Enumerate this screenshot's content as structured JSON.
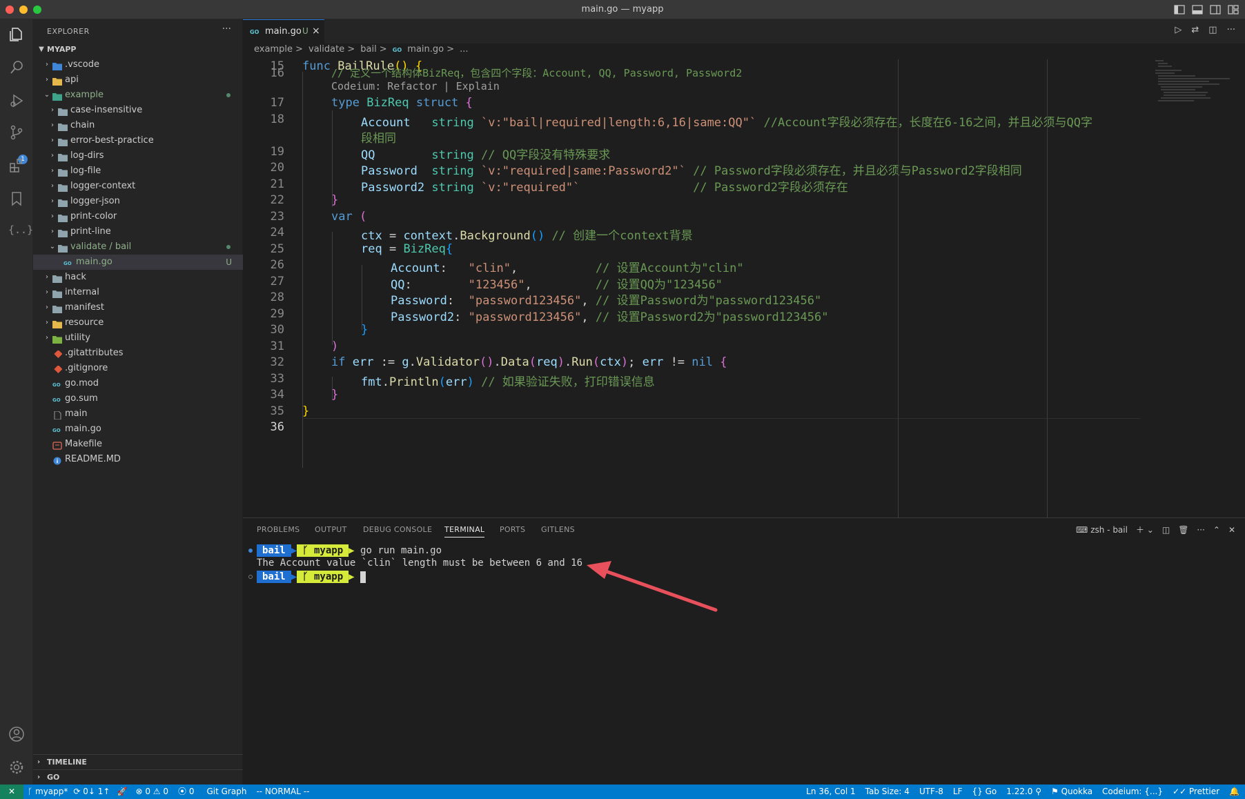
{
  "window": {
    "title": "main.go — myapp"
  },
  "explorer": {
    "header": "EXPLORER",
    "more": "···",
    "root": "MYAPP",
    "items": [
      {
        "label": ".vscode",
        "indent": 0,
        "type": "folder",
        "expanded": false
      },
      {
        "label": "api",
        "indent": 0,
        "type": "folder",
        "expanded": false
      },
      {
        "label": "example",
        "indent": 0,
        "type": "folder",
        "expanded": true,
        "status": "dot"
      },
      {
        "label": "case-insensitive",
        "indent": 1,
        "type": "folder",
        "expanded": false
      },
      {
        "label": "chain",
        "indent": 1,
        "type": "folder",
        "expanded": false
      },
      {
        "label": "error-best-practice",
        "indent": 1,
        "type": "folder",
        "expanded": false
      },
      {
        "label": "log-dirs",
        "indent": 1,
        "type": "folder",
        "expanded": false
      },
      {
        "label": "log-file",
        "indent": 1,
        "type": "folder",
        "expanded": false
      },
      {
        "label": "logger-context",
        "indent": 1,
        "type": "folder",
        "expanded": false
      },
      {
        "label": "logger-json",
        "indent": 1,
        "type": "folder",
        "expanded": false
      },
      {
        "label": "print-color",
        "indent": 1,
        "type": "folder",
        "expanded": false
      },
      {
        "label": "print-line",
        "indent": 1,
        "type": "folder",
        "expanded": false
      },
      {
        "label": "validate / bail",
        "indent": 1,
        "type": "folder",
        "expanded": true,
        "status": "dot"
      },
      {
        "label": "main.go",
        "indent": 2,
        "type": "go",
        "selected": true,
        "status": "U"
      },
      {
        "label": "hack",
        "indent": 0,
        "type": "folder",
        "expanded": false
      },
      {
        "label": "internal",
        "indent": 0,
        "type": "folder",
        "expanded": false
      },
      {
        "label": "manifest",
        "indent": 0,
        "type": "folder",
        "expanded": false
      },
      {
        "label": "resource",
        "indent": 0,
        "type": "folder",
        "expanded": false
      },
      {
        "label": "utility",
        "indent": 0,
        "type": "folder",
        "expanded": false
      },
      {
        "label": ".gitattributes",
        "indent": 0,
        "type": "git"
      },
      {
        "label": ".gitignore",
        "indent": 0,
        "type": "git"
      },
      {
        "label": "go.mod",
        "indent": 0,
        "type": "go"
      },
      {
        "label": "go.sum",
        "indent": 0,
        "type": "go"
      },
      {
        "label": "main",
        "indent": 0,
        "type": "file"
      },
      {
        "label": "main.go",
        "indent": 0,
        "type": "go"
      },
      {
        "label": "Makefile",
        "indent": 0,
        "type": "make"
      },
      {
        "label": "README.MD",
        "indent": 0,
        "type": "info"
      }
    ],
    "sections": [
      "TIMELINE",
      "GO"
    ]
  },
  "activity": {
    "scm_badge": "1"
  },
  "tab": {
    "icon": "GO",
    "name": "main.go",
    "status": "U",
    "close": "×"
  },
  "breadcrumb": [
    "example",
    ">",
    "validate",
    ">",
    "bail",
    ">",
    "GO",
    "main.go",
    ">",
    "..."
  ],
  "code": {
    "lens": "Codeium: Refactor | Explain",
    "comment16": "// 定义一个结构体BizReq，包含四个字段：Account, QQ, Password, Password2",
    "account_tag": "`v:\"bail|required|length:6,16|same:QQ\"`",
    "account_comment": "//Account字段必须存在，长度在6-16之间，并且必须与QQ字",
    "account_comment2": "段相同",
    "qq_comment": "// QQ字段没有特殊要求",
    "pwd_tag": "`v:\"required|same:Password2\"`",
    "pwd_comment": "// Password字段必须存在，并且必须与Password2字段相同",
    "pwd2_tag": "`v:\"required\"`",
    "pwd2_comment": "// Password2字段必须存在",
    "ctx_comment": "// 创建一个context背景",
    "acc_val": "\"clin\"",
    "acc_cm": "// 设置Account为\"clin\"",
    "qq_val": "\"123456\"",
    "qq_cm": "// 设置QQ为\"123456\"",
    "pw_val": "\"password123456\"",
    "pw_cm": "// 设置Password为\"password123456\"",
    "pw2_cm": "// 设置Password2为\"password123456\"",
    "err_comment": "// 如果验证失败，打印错误信息"
  },
  "panel": {
    "tabs": [
      "PROBLEMS",
      "OUTPUT",
      "DEBUG CONSOLE",
      "TERMINAL",
      "PORTS",
      "GITLENS"
    ],
    "active_tab": "TERMINAL",
    "shell": "zsh - bail",
    "prompt_dir": "bail",
    "prompt_repo": "myapp",
    "command": "go run main.go",
    "output": "The Account value `clin` length must be between 6 and 16"
  },
  "status": {
    "branch": "myapp*",
    "sync": "0↓ 1↑",
    "problems": "0",
    "warnings": "0",
    "ports": "0",
    "git_graph": "Git Graph",
    "mode": "-- NORMAL --",
    "position": "Ln 36, Col 1",
    "tab_size": "Tab Size: 4",
    "encoding": "UTF-8",
    "eol": "LF",
    "language": "Go",
    "go_version": "1.22.0",
    "quokka": "Quokka",
    "codeium": "Codeium: {...}",
    "prettier": "Prettier"
  },
  "colors": {
    "accent": "#007acc",
    "annotation_arrow": "#e8505b"
  }
}
